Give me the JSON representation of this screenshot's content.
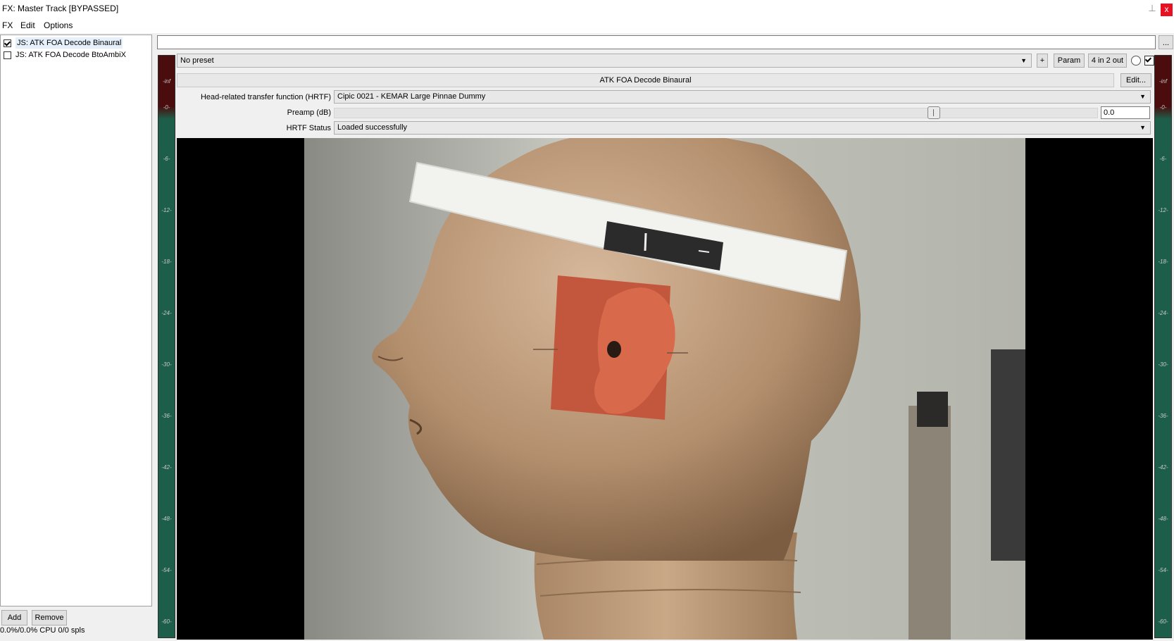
{
  "window": {
    "title": "FX: Master Track [BYPASSED]",
    "close_label": "x",
    "pin_glyph": "⊥"
  },
  "menu": [
    "FX",
    "Edit",
    "Options"
  ],
  "fx_chain": [
    {
      "label": "JS: ATK FOA Decode Binaural",
      "enabled": true
    },
    {
      "label": "JS: ATK FOA Decode BtoAmbiX",
      "enabled": false
    }
  ],
  "buttons": {
    "add": "Add",
    "remove": "Remove",
    "plus": "+",
    "param": "Param",
    "io": "4 in 2 out",
    "edit": "Edit...",
    "dots": "..."
  },
  "status": {
    "cpu": "0.0%/0.0% CPU 0/0 spls"
  },
  "preset": {
    "value": "No preset"
  },
  "plugin": {
    "name": "ATK FOA Decode Binaural",
    "params": [
      {
        "label": "Head-related transfer function (HRTF)",
        "value": "Cipic 0021 - KEMAR Large Pinnae Dummy"
      },
      {
        "label": "Preamp (dB)",
        "value": "0.0",
        "fraction": 0.79
      },
      {
        "label": "HRTF Status",
        "value": "Loaded successfully"
      }
    ]
  },
  "meters": {
    "left_top": "-inf",
    "right_top": "-inf",
    "scale": [
      "-0-",
      "-6-",
      "-12-",
      "-18-",
      "-24-",
      "-30-",
      "-36-",
      "-42-",
      "-48-",
      "-54-",
      "-60-"
    ]
  },
  "colors": {
    "meter_green": "#1d5e4a",
    "meter_red": "#4a0c0c",
    "close_red": "#e81123"
  }
}
